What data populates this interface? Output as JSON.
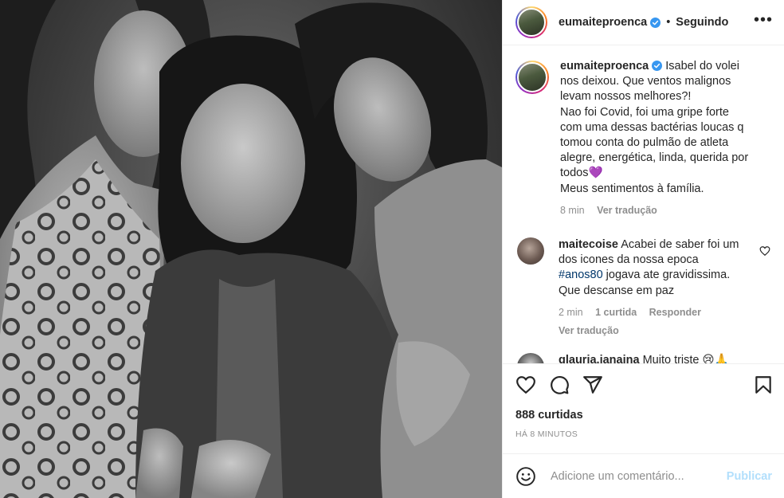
{
  "header": {
    "username": "eumaiteproenca",
    "separator": "•",
    "follow_status": "Seguindo",
    "more_label": "•••"
  },
  "caption": {
    "username": "eumaiteproenca",
    "lines": [
      "Isabel do volei",
      "nos deixou. Que ventos malignos",
      "levam nossos melhores?!",
      "Nao foi Covid, foi uma gripe forte",
      "com uma dessas bactérias loucas q",
      "tomou conta do pulmão de atleta",
      "alegre, energética, linda, querida por",
      "todos💜",
      "Meus sentimentos à família."
    ],
    "time": "8 min",
    "translate": "Ver tradução"
  },
  "comments": [
    {
      "username": "maitecoise",
      "text_a": "Acabei de saber foi um",
      "text_b": "dos icones da nossa epoca",
      "hashtag": "#anos80",
      "text_c": " jogava ate gravidissima.",
      "text_d": "Que descanse em paz",
      "time": "2 min",
      "likes": "1 curtida",
      "reply": "Responder",
      "translate": "Ver tradução"
    },
    {
      "username": "glauria.janaina",
      "text": "Muito triste 😢🙏"
    }
  ],
  "actions": {
    "likes": "888 curtidas",
    "posted": "HÁ 8 MINUTOS"
  },
  "add_comment": {
    "placeholder": "Adicione um comentário...",
    "publish": "Publicar"
  },
  "colors": {
    "text": "#262626",
    "muted": "#8e8e8e",
    "link": "#00376b",
    "verified": "#3897f0",
    "publish_disabled": "#b2dffc",
    "heart_emoji": "#9b4fd8"
  },
  "icons": {
    "verified": "verified-badge-icon",
    "like": "heart-icon",
    "comment": "comment-bubble-icon",
    "share": "paper-plane-icon",
    "save": "bookmark-icon",
    "emoji": "smiley-icon",
    "more": "more-dots-icon"
  }
}
